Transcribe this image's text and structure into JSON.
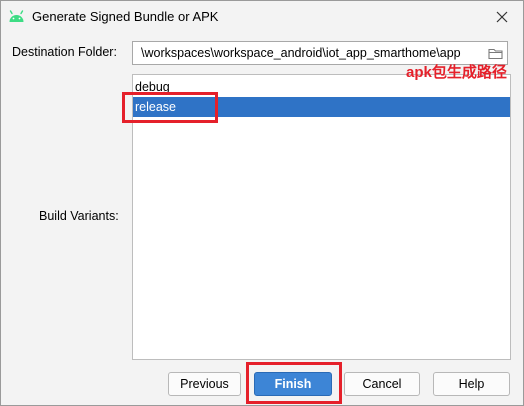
{
  "window": {
    "title": "Generate Signed Bundle or APK",
    "icon": "android-icon",
    "close_icon": "close-icon"
  },
  "destination": {
    "label": "Destination Folder:",
    "value": "\\workspaces\\workspace_android\\iot_app_smarthome\\app",
    "browse_icon": "folder-icon"
  },
  "build_variants": {
    "label": "Build Variants:",
    "items": [
      {
        "label": "debug",
        "selected": false
      },
      {
        "label": "release",
        "selected": true
      }
    ]
  },
  "annotation": {
    "text": "apk包生成路径",
    "color": "#e5202a"
  },
  "buttons": {
    "previous": "Previous",
    "finish": "Finish",
    "cancel": "Cancel",
    "help": "Help"
  },
  "colors": {
    "selection": "#2f73c6",
    "primary_button": "#3d85d6",
    "android_green": "#3ddc84"
  }
}
